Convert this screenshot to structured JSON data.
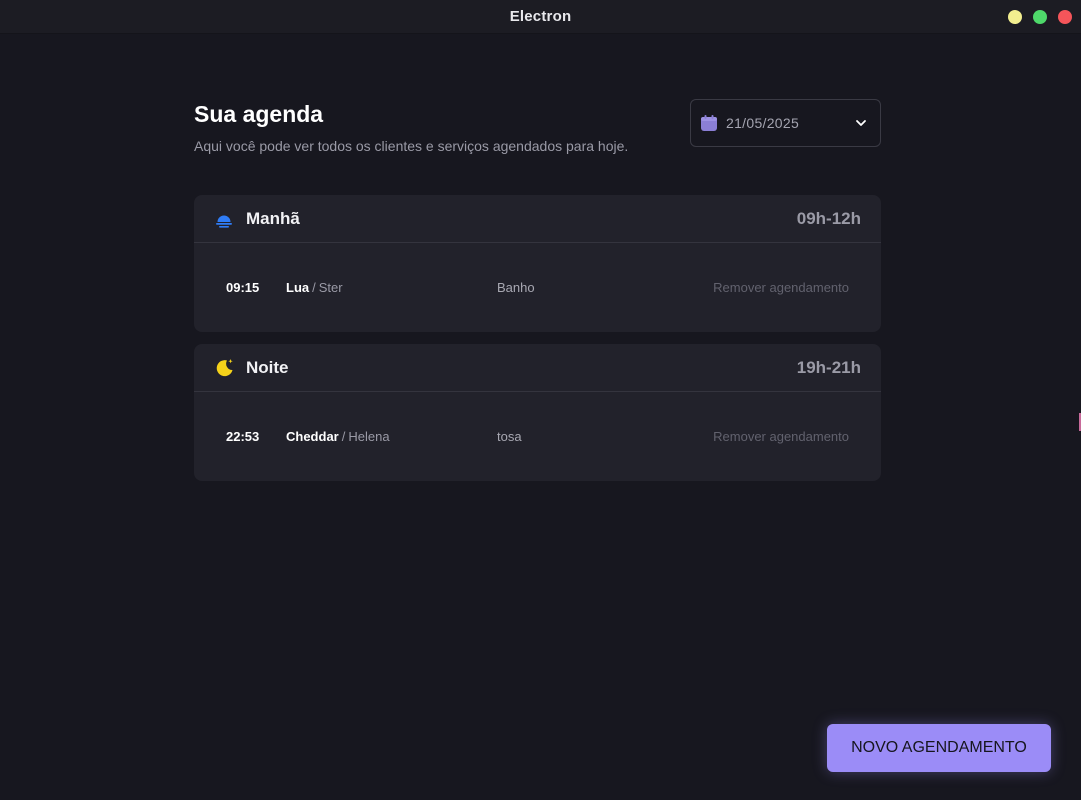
{
  "window": {
    "title": "Electron",
    "controls": [
      {
        "name": "minimize",
        "color": "#f2ee8f"
      },
      {
        "name": "maximize",
        "color": "#4ed86a"
      },
      {
        "name": "close",
        "color": "#f5555a"
      }
    ]
  },
  "header": {
    "title": "Sua agenda",
    "subtitle": "Aqui você pode ver todos os clientes e serviços agendados para hoje."
  },
  "date_picker": {
    "value": "21/05/2025",
    "icon": "calendar-icon",
    "accent": "#8b7fd6"
  },
  "periods": [
    {
      "name": "Manhã",
      "range": "09h-12h",
      "icon": "sunrise-icon",
      "icon_color": "#2f7cf6",
      "appointments": [
        {
          "time": "09:15",
          "pet": "Lua",
          "owner": "Ster",
          "service": "Banho",
          "action": "Remover agendamento"
        }
      ]
    },
    {
      "name": "Noite",
      "range": "19h-21h",
      "icon": "moon-icon",
      "icon_color": "#f5d21a",
      "appointments": [
        {
          "time": "22:53",
          "pet": "Cheddar",
          "owner": "Helena",
          "service": "tosa",
          "action": "Remover agendamento"
        }
      ]
    }
  ],
  "new_button": {
    "label": "NOVO AGENDAMENTO",
    "color": "#9b8cf7"
  }
}
